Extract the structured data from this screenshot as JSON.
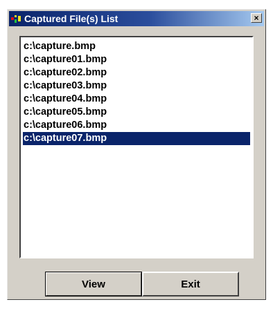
{
  "window": {
    "title": "Captured File(s) List",
    "close_glyph": "×"
  },
  "files": [
    "c:\\capture.bmp",
    "c:\\capture01.bmp",
    "c:\\capture02.bmp",
    "c:\\capture03.bmp",
    "c:\\capture04.bmp",
    "c:\\capture05.bmp",
    "c:\\capture06.bmp",
    "c:\\capture07.bmp"
  ],
  "selected_file": "c:\\capture07.bmp",
  "buttons": {
    "view_label": "View",
    "exit_label": "Exit"
  },
  "icons": {
    "app": "app-icon",
    "close": "close-icon"
  },
  "colors": {
    "titlebar": "#0a246a",
    "selection": "#0a246a",
    "face": "#d4d0c8"
  }
}
